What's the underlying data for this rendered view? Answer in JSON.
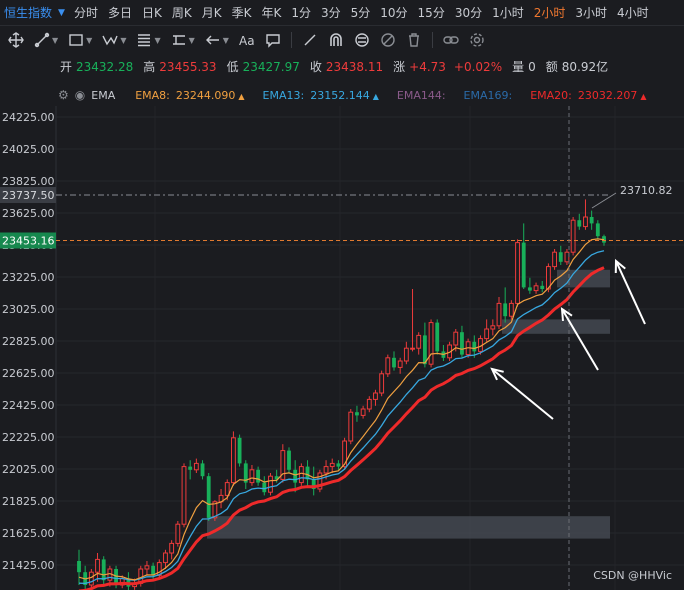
{
  "header": {
    "symbol": "恒生指数",
    "periods": [
      "分时",
      "多日",
      "日K",
      "周K",
      "月K",
      "季K",
      "年K",
      "1分",
      "3分",
      "5分",
      "10分",
      "15分",
      "30分",
      "1小时",
      "2小时",
      "3小时",
      "4小时"
    ],
    "active_period": "2小时"
  },
  "quote": {
    "open_label": "开",
    "open": "23432.28",
    "high_label": "高",
    "high": "23455.33",
    "low_label": "低",
    "low": "23427.97",
    "close_label": "收",
    "close": "23438.11",
    "change_label": "涨",
    "change": "+4.73",
    "change_pct": "+0.02%",
    "volume_label": "量",
    "volume": "0",
    "amount_label": "额",
    "amount": "80.92亿"
  },
  "indicator": {
    "name": "EMA",
    "items": [
      {
        "label": "EMA8:",
        "value": "23244.090",
        "color": "#f0a040"
      },
      {
        "label": "EMA13:",
        "value": "23152.144",
        "color": "#38a8e0"
      },
      {
        "label": "EMA144:",
        "value": "",
        "color": "#8a5a8a"
      },
      {
        "label": "EMA169:",
        "value": "",
        "color": "#2a6aa8"
      },
      {
        "label": "EMA20:",
        "value": "23032.207",
        "color": "#ee2a2a"
      }
    ]
  },
  "watermark": "CSDN @HHVic",
  "chart_data": {
    "type": "candlestick",
    "yticks": [
      24225,
      24025,
      23825,
      23625,
      23425,
      23225,
      23025,
      22825,
      22625,
      22425,
      22225,
      22025,
      21825,
      21625,
      21425
    ],
    "ytick_labels": [
      "24225.00",
      "24025.00",
      "23825.00",
      "23625.00",
      "23425.00",
      "23225.00",
      "23025.00",
      "22825.00",
      "22625.00",
      "22425.00",
      "22225.00",
      "22025.00",
      "21825.00",
      "21625.00",
      "21425.00"
    ],
    "ylim": [
      21275,
      24325
    ],
    "high_marker": {
      "value": 23737.5,
      "label": "23737.50",
      "max_label": "23710.82"
    },
    "price_line": {
      "value": 23453.16,
      "label": "23453.16"
    },
    "candles": [
      [
        21450,
        21520,
        21300,
        21380
      ],
      [
        21380,
        21420,
        21250,
        21300
      ],
      [
        21300,
        21400,
        21260,
        21380
      ],
      [
        21380,
        21500,
        21320,
        21460
      ],
      [
        21460,
        21480,
        21300,
        21330
      ],
      [
        21330,
        21420,
        21290,
        21400
      ],
      [
        21400,
        21420,
        21280,
        21300
      ],
      [
        21300,
        21360,
        21280,
        21340
      ],
      [
        21340,
        21380,
        21260,
        21290
      ],
      [
        21290,
        21340,
        21270,
        21310
      ],
      [
        21310,
        21420,
        21290,
        21400
      ],
      [
        21400,
        21450,
        21360,
        21420
      ],
      [
        21420,
        21440,
        21330,
        21360
      ],
      [
        21360,
        21460,
        21340,
        21440
      ],
      [
        21440,
        21520,
        21400,
        21500
      ],
      [
        21500,
        21580,
        21460,
        21560
      ],
      [
        21560,
        21700,
        21540,
        21680
      ],
      [
        21680,
        22060,
        21660,
        22040
      ],
      [
        22040,
        22080,
        21960,
        22020
      ],
      [
        22020,
        22090,
        22000,
        22060
      ],
      [
        22060,
        22080,
        21960,
        21980
      ],
      [
        21980,
        22000,
        21700,
        21720
      ],
      [
        21720,
        21830,
        21700,
        21820
      ],
      [
        21820,
        21900,
        21780,
        21860
      ],
      [
        21860,
        21960,
        21830,
        21940
      ],
      [
        21940,
        22260,
        21920,
        22220
      ],
      [
        22220,
        22240,
        22040,
        22060
      ],
      [
        22060,
        22080,
        21900,
        21940
      ],
      [
        21940,
        22050,
        21920,
        22020
      ],
      [
        22020,
        22040,
        21920,
        21940
      ],
      [
        21940,
        21980,
        21860,
        21880
      ],
      [
        21880,
        22000,
        21860,
        21980
      ],
      [
        21980,
        22020,
        21940,
        21960
      ],
      [
        21960,
        22180,
        21940,
        22140
      ],
      [
        22140,
        22160,
        22000,
        22020
      ],
      [
        22020,
        22080,
        21880,
        21940
      ],
      [
        21940,
        22060,
        21920,
        22040
      ],
      [
        22040,
        22080,
        21920,
        21960
      ],
      [
        21960,
        22040,
        21860,
        21900
      ],
      [
        21900,
        22020,
        21880,
        22000
      ],
      [
        22000,
        22080,
        21960,
        22040
      ],
      [
        22040,
        22090,
        22000,
        22060
      ],
      [
        22060,
        22080,
        22020,
        22040
      ],
      [
        22040,
        22220,
        22020,
        22200
      ],
      [
        22200,
        22400,
        22180,
        22380
      ],
      [
        22380,
        22420,
        22320,
        22360
      ],
      [
        22360,
        22420,
        22340,
        22400
      ],
      [
        22400,
        22480,
        22380,
        22460
      ],
      [
        22460,
        22520,
        22420,
        22500
      ],
      [
        22500,
        22640,
        22480,
        22620
      ],
      [
        22620,
        22740,
        22600,
        22720
      ],
      [
        22720,
        22760,
        22640,
        22660
      ],
      [
        22660,
        22720,
        22620,
        22700
      ],
      [
        22700,
        22820,
        22680,
        22780
      ],
      [
        22780,
        23150,
        22760,
        22780
      ],
      [
        22780,
        22880,
        22740,
        22860
      ],
      [
        22860,
        22940,
        22660,
        22680
      ],
      [
        22680,
        22960,
        22660,
        22940
      ],
      [
        22940,
        22960,
        22740,
        22760
      ],
      [
        22760,
        22800,
        22700,
        22720
      ],
      [
        22720,
        22820,
        22700,
        22800
      ],
      [
        22800,
        22900,
        22760,
        22880
      ],
      [
        22880,
        22920,
        22720,
        22740
      ],
      [
        22740,
        22840,
        22720,
        22820
      ],
      [
        22820,
        22860,
        22720,
        22760
      ],
      [
        22760,
        22860,
        22740,
        22840
      ],
      [
        22840,
        22960,
        22820,
        22900
      ],
      [
        22900,
        22960,
        22860,
        22920
      ],
      [
        22920,
        23100,
        22900,
        23060
      ],
      [
        23060,
        23160,
        22940,
        22980
      ],
      [
        22980,
        23080,
        22960,
        23060
      ],
      [
        23060,
        23460,
        23040,
        23440
      ],
      [
        23440,
        23560,
        23150,
        23160
      ],
      [
        23160,
        23220,
        23120,
        23140
      ],
      [
        23140,
        23190,
        23120,
        23170
      ],
      [
        23170,
        23200,
        23130,
        23150
      ],
      [
        23150,
        23310,
        23130,
        23290
      ],
      [
        23290,
        23400,
        23270,
        23380
      ],
      [
        23380,
        23420,
        23300,
        23320
      ],
      [
        23320,
        23400,
        23300,
        23380
      ],
      [
        23380,
        23600,
        23360,
        23580
      ],
      [
        23580,
        23620,
        23520,
        23540
      ],
      [
        23540,
        23710,
        23520,
        23600
      ],
      [
        23600,
        23640,
        23520,
        23560
      ],
      [
        23560,
        23580,
        23460,
        23480
      ],
      [
        23480,
        23490,
        23420,
        23440
      ]
    ],
    "ema8_last": 23244.09,
    "ema13_last": 23152.144,
    "ema20_last": 23032.207,
    "zones": [
      {
        "from": 21590,
        "to": 21730
      },
      {
        "from": 22870,
        "to": 22960
      },
      {
        "from": 23160,
        "to": 23270
      }
    ]
  }
}
